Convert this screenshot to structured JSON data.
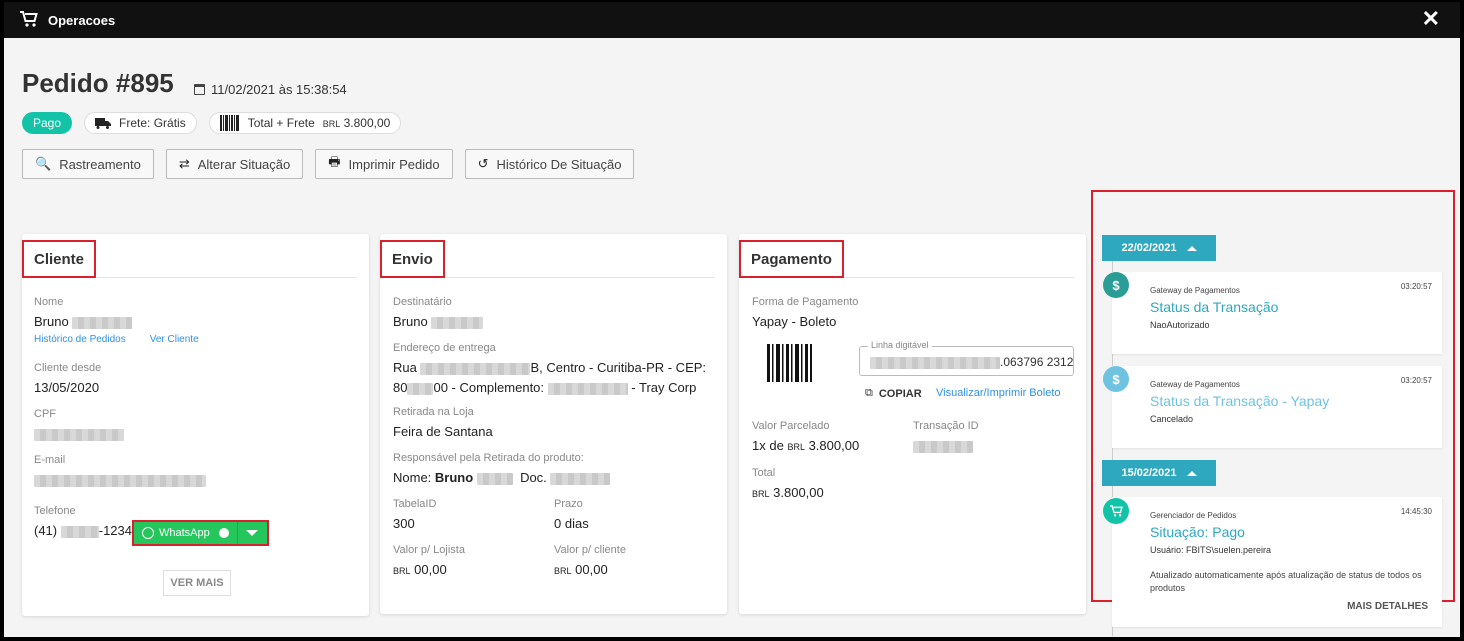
{
  "window": {
    "title": "Operacoes",
    "close_label": "✕"
  },
  "order": {
    "title": "Pedido #895",
    "date": "11/02/2021 às 15:38:54",
    "badges": {
      "paid": "Pago",
      "shipping": "Frete: Grátis",
      "total_prefix": "Total + Frete",
      "currency": "BRL",
      "total_value": "3.800,00"
    },
    "actions": [
      "Rastreamento",
      "Alterar Situação",
      "Imprimir Pedido",
      "Histórico De Situação"
    ]
  },
  "cliente": {
    "header": "Cliente",
    "name_label": "Nome",
    "name_value": "Bruno",
    "link_orders": "Histórico de Pedidos",
    "link_client": "Ver Cliente",
    "since_label": "Cliente desde",
    "since_value": "13/05/2020",
    "cpf_label": "CPF",
    "email_label": "E-mail",
    "phone_label": "Telefone",
    "phone_prefix": "(41)",
    "phone_suffix": "-1234",
    "whatsapp_label": "WhatsApp",
    "more_label": "VER MAIS"
  },
  "envio": {
    "header": "Envio",
    "recipient_label": "Destinatário",
    "recipient_value": "Bruno",
    "address_label": "Endereço de entrega",
    "address_line1_prefix": "Rua",
    "address_line1_suffix": "B, Centro - Curitiba-PR - CEP:",
    "address_line2_prefix": "80",
    "address_line2_mid": "00 - Complemento:",
    "address_line2_suffix": "- Tray Corp",
    "pickup_label": "Retirada na Loja",
    "pickup_value": "Feira de Santana",
    "responsible_label": "Responsável pela Retirada do produto:",
    "responsible_name_prefix": "Nome:",
    "responsible_name": "Bruno",
    "responsible_doc": "Doc.",
    "tabela_label": "TabelaID",
    "tabela_value": "300",
    "prazo_label": "Prazo",
    "prazo_value": "0 dias",
    "lojista_label": "Valor p/ Lojista",
    "lojista_currency": "BRL",
    "lojista_value": "00,00",
    "cliente_label": "Valor p/ cliente",
    "cliente_currency": "BRL",
    "cliente_value": "00,00"
  },
  "pagamento": {
    "header": "Pagamento",
    "method_label": "Forma de Pagamento",
    "method_value": "Yapay - Boleto",
    "line_label": "Linha digitável",
    "line_suffix": ".063796  2312",
    "copy_label": "COPIAR",
    "view_label": "Visualizar/Imprimir Boleto",
    "installment_label": "Valor Parcelado",
    "installment_prefix": "1x de",
    "installment_currency": "BRL",
    "installment_value": "3.800,00",
    "transaction_label": "Transação ID",
    "total_label": "Total",
    "total_currency": "BRL",
    "total_value": "3.800,00"
  },
  "timeline": {
    "groups": [
      {
        "date": "22/02/2021"
      },
      {
        "date": "15/02/2021"
      }
    ],
    "events": [
      {
        "source": "Gateway de Pagamentos",
        "time": "03:20:57",
        "title": "Status da Transação",
        "desc": "NaoAutorizado"
      },
      {
        "source": "Gateway de Pagamentos",
        "time": "03:20:57",
        "title": "Status da Transação - Yapay",
        "desc": "Cancelado"
      },
      {
        "source": "Gerenciador de Pedidos",
        "time": "14:45:30",
        "title": "Situação: Pago",
        "desc": "Usuário: FBITS\\suelen.pereira",
        "note": "Atualizado automaticamente após atualização de status de todos os produtos",
        "more": "MAIS DETALHES"
      }
    ]
  },
  "colors": {
    "accent": "#2ea8bf",
    "paid": "#12c3a8",
    "whatsapp": "#25c75c",
    "highlight": "#d9212e"
  }
}
